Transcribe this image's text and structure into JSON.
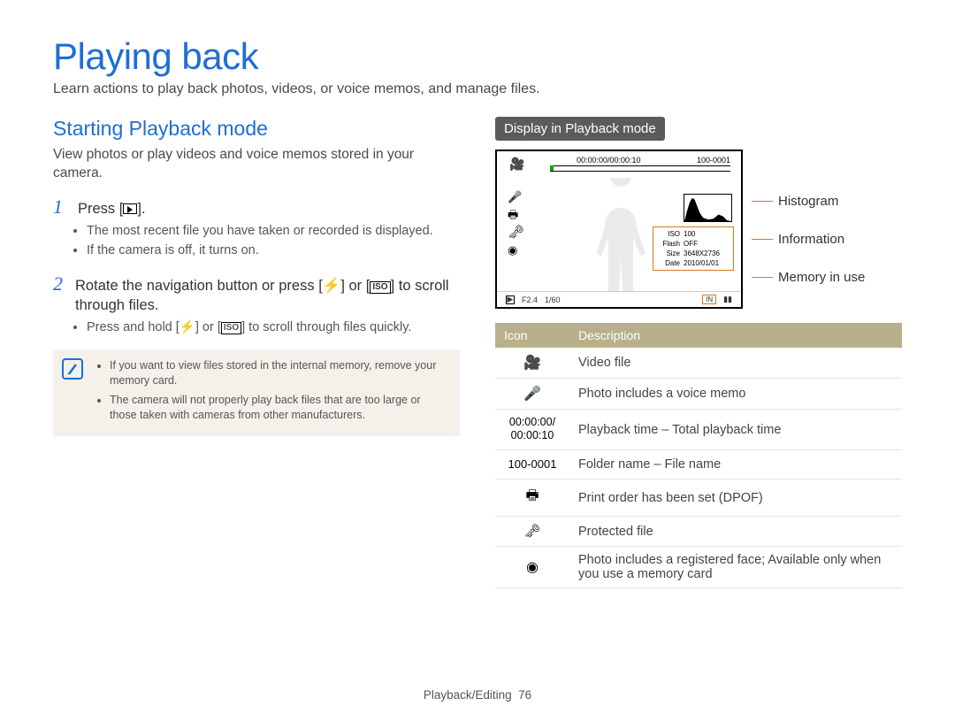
{
  "title": "Playing back",
  "intro": "Learn actions to play back photos, videos, or voice memos, and manage files.",
  "left": {
    "heading": "Starting Playback mode",
    "lead": "View photos or play videos and voice memos stored in your camera.",
    "step1_num": "1",
    "step1_text_a": "Press [",
    "step1_text_b": "].",
    "step1_bullets": [
      "The most recent file you have taken or recorded is displayed.",
      "If the camera is off, it turns on."
    ],
    "step2_num": "2",
    "step2_text_a": "Rotate the navigation button or press [",
    "step2_text_b": "] or [",
    "step2_text_c": "] to scroll through files.",
    "step2_iso": "ISO",
    "step2_bullet_a": "Press and hold [",
    "step2_bullet_b": "] or [",
    "step2_bullet_c": "] to scroll through files quickly.",
    "notes": [
      "If you want to view files stored in the internal memory, remove your memory card.",
      "The camera will not properly play back files that are too large or those taken with cameras from other manufacturers."
    ]
  },
  "right": {
    "pill": "Display in Playback mode",
    "screen": {
      "time": "00:00:00/00:00:10",
      "folder": "100-0001",
      "info_rows": [
        {
          "label": "ISO",
          "value": "100"
        },
        {
          "label": "Flash",
          "value": "OFF"
        },
        {
          "label": "Size",
          "value": "3648X2736"
        },
        {
          "label": "Date",
          "value": "2010/01/01"
        }
      ],
      "aperture": "F2.4",
      "shutter": "1/60",
      "mem_label": "IN"
    },
    "callouts": {
      "histogram": "Histogram",
      "information": "Information",
      "memory": "Memory in use"
    },
    "table": {
      "head_icon": "Icon",
      "head_desc": "Description",
      "rows": [
        {
          "icon_name": "video-file-icon",
          "icon_glyph": "🎥",
          "desc": "Video file"
        },
        {
          "icon_name": "voice-memo-icon",
          "icon_glyph": "🎤",
          "desc": "Photo includes a voice memo"
        },
        {
          "icon_name": "playback-time-text",
          "icon_text": "00:00:00/\n00:00:10",
          "desc": "Playback time – Total playback time"
        },
        {
          "icon_name": "folder-file-text",
          "icon_text": "100-0001",
          "desc": "Folder name – File name"
        },
        {
          "icon_name": "print-order-icon",
          "icon_glyph": "🖶",
          "desc": "Print order has been set (DPOF)"
        },
        {
          "icon_name": "protected-icon",
          "icon_glyph": "🗝",
          "desc": "Protected file"
        },
        {
          "icon_name": "registered-face-icon",
          "icon_glyph": "◉",
          "desc": "Photo includes a registered face; Available only when you use a memory card"
        }
      ]
    }
  },
  "footer": {
    "section": "Playback/Editing",
    "page": "76"
  },
  "colors": {
    "accent": "#1f6ed4",
    "callout": "#d97a1a",
    "table_head": "#b7b08a"
  }
}
